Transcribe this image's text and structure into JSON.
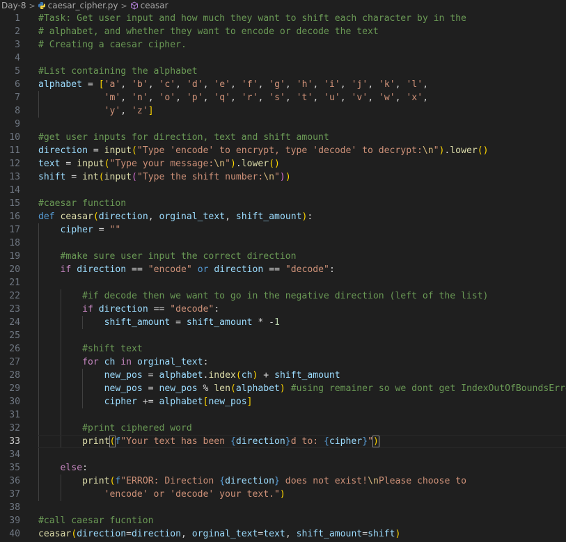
{
  "breadcrumb": {
    "folder": "Day-8",
    "file": "caesar_cipher.py",
    "symbol": "ceasar",
    "separator": ">"
  },
  "current_line": 33,
  "colors": {
    "background": "#1f1f1f",
    "comment": "#6a9955",
    "string": "#ce9178",
    "keyword": "#569cd6",
    "control": "#c586c0",
    "function": "#dcdcaa",
    "variable": "#9cdcfe",
    "number": "#b5cea8",
    "bracket": "#ffd700",
    "escape": "#d7ba7d"
  },
  "lines": [
    [
      [
        "cmt",
        "#Task: Get user input and how much they want to shift each character by in the"
      ]
    ],
    [
      [
        "cmt",
        "# alphabet, and whether they want to encode or decode the text"
      ]
    ],
    [
      [
        "cmt",
        "# Creating a caesar cipher."
      ]
    ],
    [],
    [
      [
        "cmt",
        "#List containing the alphabet"
      ]
    ],
    [
      [
        "var",
        "alphabet"
      ],
      [
        "op",
        " = "
      ],
      [
        "brk",
        "["
      ],
      [
        "str",
        "'a'"
      ],
      [
        "op",
        ", "
      ],
      [
        "str",
        "'b'"
      ],
      [
        "op",
        ", "
      ],
      [
        "str",
        "'c'"
      ],
      [
        "op",
        ", "
      ],
      [
        "str",
        "'d'"
      ],
      [
        "op",
        ", "
      ],
      [
        "str",
        "'e'"
      ],
      [
        "op",
        ", "
      ],
      [
        "str",
        "'f'"
      ],
      [
        "op",
        ", "
      ],
      [
        "str",
        "'g'"
      ],
      [
        "op",
        ", "
      ],
      [
        "str",
        "'h'"
      ],
      [
        "op",
        ", "
      ],
      [
        "str",
        "'i'"
      ],
      [
        "op",
        ", "
      ],
      [
        "str",
        "'j'"
      ],
      [
        "op",
        ", "
      ],
      [
        "str",
        "'k'"
      ],
      [
        "op",
        ", "
      ],
      [
        "str",
        "'l'"
      ],
      [
        "op",
        ","
      ]
    ],
    [
      [
        "op",
        "            "
      ],
      [
        "str",
        "'m'"
      ],
      [
        "op",
        ", "
      ],
      [
        "str",
        "'n'"
      ],
      [
        "op",
        ", "
      ],
      [
        "str",
        "'o'"
      ],
      [
        "op",
        ", "
      ],
      [
        "str",
        "'p'"
      ],
      [
        "op",
        ", "
      ],
      [
        "str",
        "'q'"
      ],
      [
        "op",
        ", "
      ],
      [
        "str",
        "'r'"
      ],
      [
        "op",
        ", "
      ],
      [
        "str",
        "'s'"
      ],
      [
        "op",
        ", "
      ],
      [
        "str",
        "'t'"
      ],
      [
        "op",
        ", "
      ],
      [
        "str",
        "'u'"
      ],
      [
        "op",
        ", "
      ],
      [
        "str",
        "'v'"
      ],
      [
        "op",
        ", "
      ],
      [
        "str",
        "'w'"
      ],
      [
        "op",
        ", "
      ],
      [
        "str",
        "'x'"
      ],
      [
        "op",
        ","
      ]
    ],
    [
      [
        "op",
        "            "
      ],
      [
        "str",
        "'y'"
      ],
      [
        "op",
        ", "
      ],
      [
        "str",
        "'z'"
      ],
      [
        "brk",
        "]"
      ]
    ],
    [],
    [
      [
        "cmt",
        "#get user inputs for direction, text and shift amount"
      ]
    ],
    [
      [
        "var",
        "direction"
      ],
      [
        "op",
        " = "
      ],
      [
        "fn",
        "input"
      ],
      [
        "brk",
        "("
      ],
      [
        "str",
        "\"Type 'encode' to encrypt, type 'decode' to decrypt:"
      ],
      [
        "esc",
        "\\n"
      ],
      [
        "str",
        "\""
      ],
      [
        "brk",
        ")"
      ],
      [
        "op",
        "."
      ],
      [
        "fn",
        "lower"
      ],
      [
        "brk",
        "()"
      ]
    ],
    [
      [
        "var",
        "text"
      ],
      [
        "op",
        " = "
      ],
      [
        "fn",
        "input"
      ],
      [
        "brk",
        "("
      ],
      [
        "str",
        "\"Type your message:"
      ],
      [
        "esc",
        "\\n"
      ],
      [
        "str",
        "\""
      ],
      [
        "brk",
        ")"
      ],
      [
        "op",
        "."
      ],
      [
        "fn",
        "lower"
      ],
      [
        "brk",
        "()"
      ]
    ],
    [
      [
        "var",
        "shift"
      ],
      [
        "op",
        " = "
      ],
      [
        "fn",
        "int"
      ],
      [
        "brk",
        "("
      ],
      [
        "fn",
        "input"
      ],
      [
        "brk2",
        "("
      ],
      [
        "str",
        "\"Type the shift number:"
      ],
      [
        "esc",
        "\\n"
      ],
      [
        "str",
        "\""
      ],
      [
        "brk2",
        ")"
      ],
      [
        "brk",
        ")"
      ]
    ],
    [],
    [
      [
        "cmt",
        "#caesar function"
      ]
    ],
    [
      [
        "kw",
        "def"
      ],
      [
        "op",
        " "
      ],
      [
        "fn",
        "ceasar"
      ],
      [
        "brk",
        "("
      ],
      [
        "var",
        "direction"
      ],
      [
        "op",
        ", "
      ],
      [
        "var",
        "orginal_text"
      ],
      [
        "op",
        ", "
      ],
      [
        "var",
        "shift_amount"
      ],
      [
        "brk",
        ")"
      ],
      [
        "op",
        ":"
      ]
    ],
    [
      [
        "op",
        "    "
      ],
      [
        "var",
        "cipher"
      ],
      [
        "op",
        " = "
      ],
      [
        "str",
        "\"\""
      ]
    ],
    [],
    [
      [
        "op",
        "    "
      ],
      [
        "cmt",
        "#make sure user input the correct direction"
      ]
    ],
    [
      [
        "op",
        "    "
      ],
      [
        "ctl",
        "if"
      ],
      [
        "op",
        " "
      ],
      [
        "var",
        "direction"
      ],
      [
        "op",
        " == "
      ],
      [
        "str",
        "\"encode\""
      ],
      [
        "op",
        " "
      ],
      [
        "kw",
        "or"
      ],
      [
        "op",
        " "
      ],
      [
        "var",
        "direction"
      ],
      [
        "op",
        " == "
      ],
      [
        "str",
        "\"decode\""
      ],
      [
        "op",
        ":"
      ]
    ],
    [],
    [
      [
        "op",
        "        "
      ],
      [
        "cmt",
        "#if decode then we want to go in the negative direction (left of the list)"
      ]
    ],
    [
      [
        "op",
        "        "
      ],
      [
        "ctl",
        "if"
      ],
      [
        "op",
        " "
      ],
      [
        "var",
        "direction"
      ],
      [
        "op",
        " == "
      ],
      [
        "str",
        "\"decode\""
      ],
      [
        "op",
        ":"
      ]
    ],
    [
      [
        "op",
        "            "
      ],
      [
        "var",
        "shift_amount"
      ],
      [
        "op",
        " = "
      ],
      [
        "var",
        "shift_amount"
      ],
      [
        "op",
        " * -"
      ],
      [
        "num",
        "1"
      ]
    ],
    [],
    [
      [
        "op",
        "        "
      ],
      [
        "cmt",
        "#shift text"
      ]
    ],
    [
      [
        "op",
        "        "
      ],
      [
        "ctl",
        "for"
      ],
      [
        "op",
        " "
      ],
      [
        "var",
        "ch"
      ],
      [
        "op",
        " "
      ],
      [
        "ctl",
        "in"
      ],
      [
        "op",
        " "
      ],
      [
        "var",
        "orginal_text"
      ],
      [
        "op",
        ":"
      ]
    ],
    [
      [
        "op",
        "            "
      ],
      [
        "var",
        "new_pos"
      ],
      [
        "op",
        " = "
      ],
      [
        "var",
        "alphabet"
      ],
      [
        "op",
        "."
      ],
      [
        "fn",
        "index"
      ],
      [
        "brk",
        "("
      ],
      [
        "var",
        "ch"
      ],
      [
        "brk",
        ")"
      ],
      [
        "op",
        " + "
      ],
      [
        "var",
        "shift_amount"
      ]
    ],
    [
      [
        "op",
        "            "
      ],
      [
        "var",
        "new_pos"
      ],
      [
        "op",
        " = "
      ],
      [
        "var",
        "new_pos"
      ],
      [
        "op",
        " % "
      ],
      [
        "fn",
        "len"
      ],
      [
        "brk",
        "("
      ],
      [
        "var",
        "alphabet"
      ],
      [
        "brk",
        ")"
      ],
      [
        "op",
        " "
      ],
      [
        "cmt",
        "#using remainer so we dont get IndexOutOfBoundsError"
      ]
    ],
    [
      [
        "op",
        "            "
      ],
      [
        "var",
        "cipher"
      ],
      [
        "op",
        " += "
      ],
      [
        "var",
        "alphabet"
      ],
      [
        "brk",
        "["
      ],
      [
        "var",
        "new_pos"
      ],
      [
        "brk",
        "]"
      ]
    ],
    [],
    [
      [
        "op",
        "        "
      ],
      [
        "cmt",
        "#print ciphered word"
      ]
    ],
    [
      [
        "op",
        "        "
      ],
      [
        "fn",
        "print"
      ],
      [
        "brk",
        "("
      ],
      [
        "kw",
        "f"
      ],
      [
        "str",
        "\"Your text has been "
      ],
      [
        "ph",
        "{"
      ],
      [
        "var",
        "direction"
      ],
      [
        "ph",
        "}"
      ],
      [
        "str",
        "d to: "
      ],
      [
        "ph",
        "{"
      ],
      [
        "var",
        "cipher"
      ],
      [
        "ph",
        "}"
      ],
      [
        "str",
        "\""
      ],
      [
        "brk",
        ")"
      ]
    ],
    [],
    [
      [
        "op",
        "    "
      ],
      [
        "ctl",
        "else"
      ],
      [
        "op",
        ":"
      ]
    ],
    [
      [
        "op",
        "        "
      ],
      [
        "fn",
        "print"
      ],
      [
        "brk",
        "("
      ],
      [
        "kw",
        "f"
      ],
      [
        "str",
        "\"ERROR: Direction "
      ],
      [
        "ph",
        "{"
      ],
      [
        "var",
        "direction"
      ],
      [
        "ph",
        "}"
      ],
      [
        "str",
        " does not exist!"
      ],
      [
        "esc",
        "\\n"
      ],
      [
        "str",
        "Please choose to"
      ]
    ],
    [
      [
        "op",
        "            "
      ],
      [
        "str",
        "'encode' or 'decode' your text.\""
      ],
      [
        "brk",
        ")"
      ]
    ],
    [],
    [
      [
        "cmt",
        "#call caesar fucntion"
      ]
    ],
    [
      [
        "fn",
        "ceasar"
      ],
      [
        "brk",
        "("
      ],
      [
        "var",
        "direction"
      ],
      [
        "op",
        "="
      ],
      [
        "var",
        "direction"
      ],
      [
        "op",
        ", "
      ],
      [
        "var",
        "orginal_text"
      ],
      [
        "op",
        "="
      ],
      [
        "var",
        "text"
      ],
      [
        "op",
        ", "
      ],
      [
        "var",
        "shift_amount"
      ],
      [
        "op",
        "="
      ],
      [
        "var",
        "shift"
      ],
      [
        "brk",
        ")"
      ]
    ]
  ]
}
